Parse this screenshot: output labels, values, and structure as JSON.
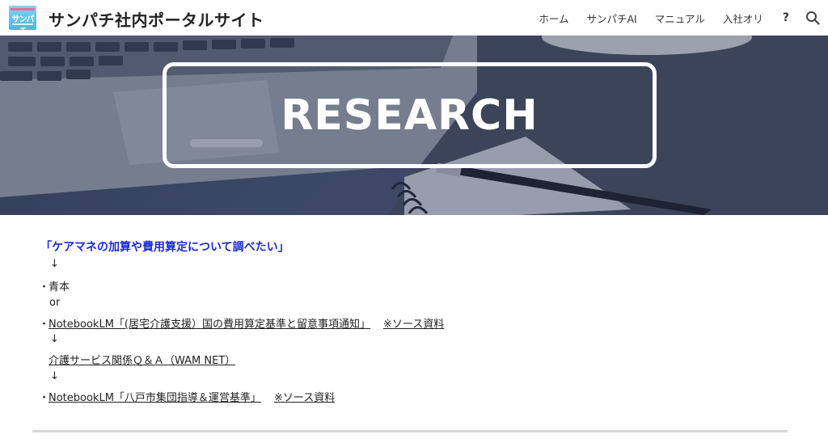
{
  "header": {
    "logo_text": "サンパチ",
    "site_title": "サンパチ社内ポータルサイト",
    "nav": [
      "ホーム",
      "サンパチAI",
      "マニュアル",
      "入社オリ",
      "?"
    ],
    "search_icon": "search-icon"
  },
  "hero": {
    "title": "RESEARCH"
  },
  "content": {
    "heading": "「ケアマネの加算や費用算定について調べたい」",
    "arrow1": "↓",
    "item1_bullet": "・",
    "item1": "青本",
    "or": "or",
    "item2_bullet": "・",
    "item2_link": "NotebookLM「(居宅介護支援）国の費用算定基準と留意事項通知」",
    "item2_source": "※ソース資料",
    "arrow2": "↓",
    "item3_link": "介護サービス関係Ｑ＆Ａ（WAM NET）",
    "arrow3": "↓",
    "item4_bullet": "・",
    "item4_link": "NotebookLM「八戸市集団指導＆運営基準」",
    "item4_source": "※ソース資料"
  },
  "colors": {
    "heading": "#1a2bd6",
    "logo_bg": "#4ab6e6",
    "hero_overlay": "#2d3a5c"
  }
}
